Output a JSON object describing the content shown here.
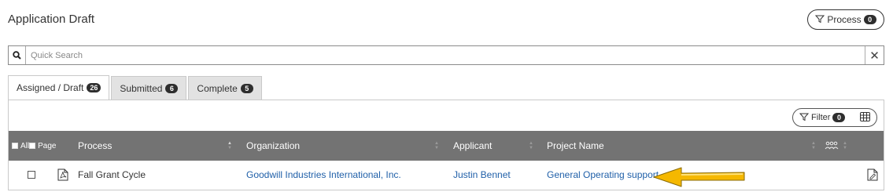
{
  "page": {
    "title": "Application Draft",
    "process_label": "Process",
    "process_count": "0"
  },
  "search": {
    "placeholder": "Quick Search"
  },
  "tabs": [
    {
      "label": "Assigned / Draft",
      "count": "26"
    },
    {
      "label": "Submitted",
      "count": "6"
    },
    {
      "label": "Complete",
      "count": "5"
    }
  ],
  "toolbar": {
    "filter_label": "Filter",
    "filter_count": "0"
  },
  "table": {
    "header_all": "All",
    "header_page": "Page",
    "columns": [
      "Process",
      "Organization",
      "Applicant",
      "Project Name"
    ],
    "rows": [
      {
        "process": "Fall Grant Cycle",
        "organization": "Goodwill Industries International, Inc.",
        "applicant": "Justin Bennet",
        "project_name": "General Operating support"
      }
    ]
  },
  "colors": {
    "header_bg": "#737373",
    "link": "#1f5fa8",
    "annotation_arrow": "#f5b800",
    "tab_inactive": "#e2e2e2"
  }
}
